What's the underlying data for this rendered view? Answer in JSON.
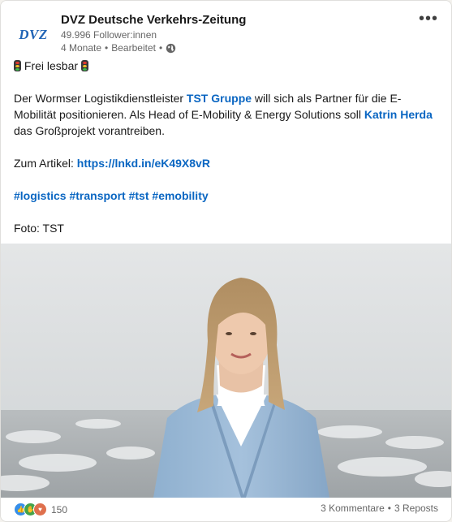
{
  "author": {
    "name": "DVZ Deutsche Verkehrs-Zeitung",
    "logo_text": "DVZ",
    "followers": "49.996 Follower:innen",
    "timestamp": "4 Monate",
    "separator": "•",
    "edited": "Bearbeitet",
    "separator2": "•"
  },
  "post": {
    "heading": "Frei lesbar",
    "p1_a": "Der Wormser Logistikdienstleister ",
    "p1_link1": "TST Gruppe",
    "p1_b": " will sich als Partner für die E-Mobilität positionieren. Als Head of E-Mobility & Energy Solutions soll ",
    "p1_link2": "Katrin Herda",
    "p1_c": " das Großprojekt vorantreiben.",
    "article_label": "Zum Artikel: ",
    "article_link": "https://lnkd.in/eK49X8vR",
    "hashtags": [
      "#logistics",
      "#transport",
      "#tst",
      "#emobility"
    ],
    "photo_credit": "Foto: TST"
  },
  "footer": {
    "reaction_count": "150",
    "comments": "3 Kommentare",
    "dot": "•",
    "reposts": "3 Reposts"
  },
  "icons": [
    "traffic-light-icon",
    "globe-icon",
    "more-options-icon",
    "like-icon",
    "celebrate-icon",
    "love-icon"
  ],
  "colors": {
    "link": "#0a66c2",
    "brand": "#1f63b5",
    "muted": "#666666"
  }
}
